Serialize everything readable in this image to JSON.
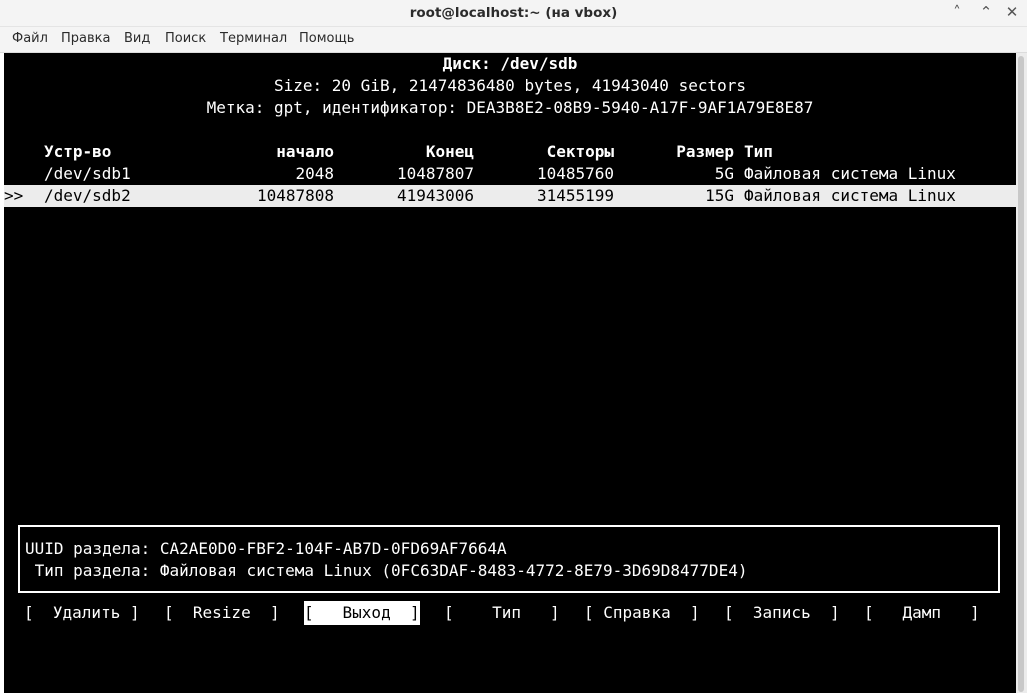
{
  "window": {
    "title": "root@localhost:~ (на vbox)",
    "controls": [
      "˄",
      "⌃",
      "✕"
    ]
  },
  "menu": {
    "items": [
      "Файл",
      "Правка",
      "Вид",
      "Поиск",
      "Терминал",
      "Помощь"
    ]
  },
  "disk": {
    "label": "Диск: /dev/sdb",
    "size": "Size: 20 GiB, 21474836480 bytes, 41943040 sectors",
    "meta": "Метка: gpt, идентификатор: DEA3B8E2-08B9-5940-A17F-9AF1A79E8E87"
  },
  "table": {
    "headers": {
      "device": "Устр-во",
      "start": "начало",
      "end": "Конец",
      "sectors": "Секторы",
      "size": "Размер",
      "type": "Тип"
    },
    "selected_marker": ">>",
    "rows": [
      {
        "device": "/dev/sdb1",
        "start": "2048",
        "end": "10487807",
        "sectors": "10485760",
        "size": "5G",
        "type": "Файловая система Linux",
        "selected": false
      },
      {
        "device": "/dev/sdb2",
        "start": "10487808",
        "end": "41943006",
        "sectors": "31455199",
        "size": "15G",
        "type": "Файловая система Linux",
        "selected": true
      }
    ]
  },
  "info": {
    "uuid_line": "UUID раздела: CA2AE0D0-FBF2-104F-AB7D-0FD69AF7664A",
    "type_line": " Тип раздела: Файловая система Linux (0FC63DAF-8483-4772-8E79-3D69D8477DE4)"
  },
  "actions": {
    "delete": "[  Удалить ]",
    "resize": "[  Resize  ]",
    "quit": "[   Выход  ]",
    "type": "[    Тип   ]",
    "help": "[ Справка  ]",
    "write": "[  Запись  ]",
    "dump": "[   Дамп   ]",
    "focused": "quit"
  }
}
